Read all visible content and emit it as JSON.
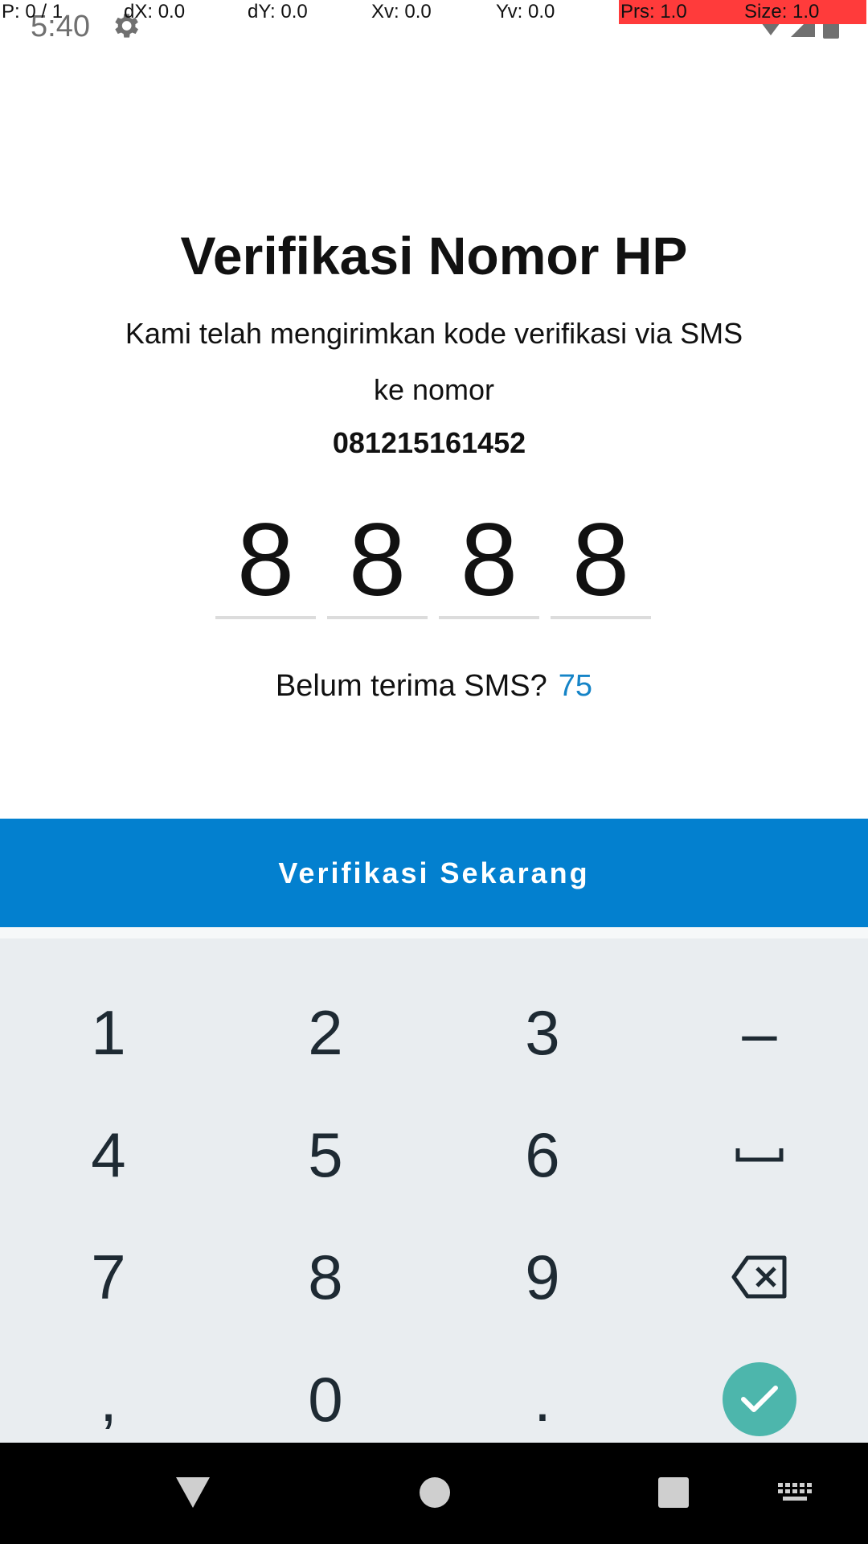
{
  "status_bar": {
    "time": "5:40"
  },
  "debug_overlay": {
    "pointer": "P: 0 / 1",
    "dx": "dX: 0.0",
    "dy": "dY: 0.0",
    "xv": "Xv: 0.0",
    "yv": "Yv: 0.0",
    "prs": "Prs: 1.0",
    "size": "Size: 1.0",
    "highlight_color": "#ff3b3b"
  },
  "verification": {
    "title": "Verifikasi Nomor HP",
    "subtitle_line1": "Kami telah mengirimkan kode verifikasi via SMS",
    "subtitle_line2": "ke nomor",
    "phone_number": "081215161452",
    "otp_digits": [
      "8",
      "8",
      "8",
      "8"
    ],
    "resend_label": "Belum terima SMS?",
    "resend_timer": "75",
    "submit_label": "Verifikasi Sekarang"
  },
  "keyboard": {
    "keys": {
      "k1": "1",
      "k2": "2",
      "k3": "3",
      "dash": "–",
      "k4": "4",
      "k5": "5",
      "k6": "6",
      "k7": "7",
      "k8": "8",
      "k9": "9",
      "comma": ",",
      "k0": "0",
      "period": "."
    },
    "icons": [
      "space-icon",
      "backspace-icon",
      "done-check-icon"
    ]
  },
  "navigation": {
    "icons": [
      "back-icon",
      "home-icon",
      "recents-icon",
      "keyboard-switch-icon"
    ]
  },
  "colors": {
    "accent": "#0380cf",
    "timer": "#1584c7",
    "enter_key": "#4db6ac",
    "keyboard_bg": "#e9edf0"
  }
}
